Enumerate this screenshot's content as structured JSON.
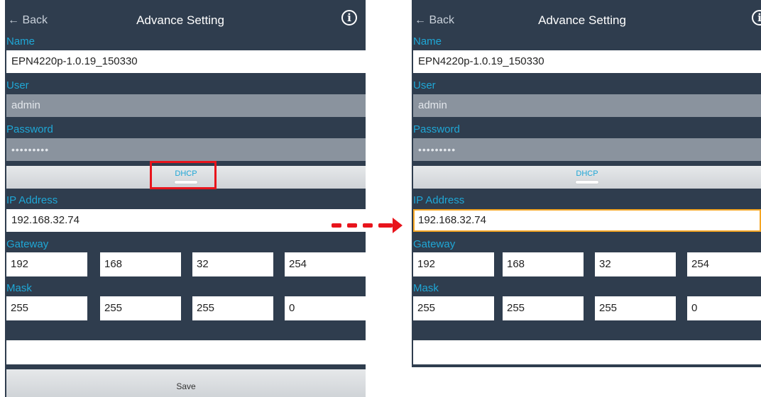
{
  "screens": {
    "before": {
      "back_label": "← Back",
      "title": "Advance Setting",
      "info_icon": "i",
      "name_label": "Name",
      "name_value": "EPN4220p-1.0.19_150330",
      "user_label": "User",
      "user_value": "admin",
      "password_label": "Password",
      "password_value": "•••••••••",
      "dhcp_label": "DHCP",
      "ip_label": "IP Address",
      "ip_value": "192.168.32.74",
      "gateway_label": "Gateway",
      "gateway": [
        "192",
        "168",
        "32",
        "254"
      ],
      "mask_label": "Mask",
      "mask": [
        "255",
        "255",
        "255",
        "0"
      ],
      "save_label": "Save"
    },
    "after": {
      "back_label": "← Back",
      "title": "Advance Setting",
      "info_icon": "i",
      "name_label": "Name",
      "name_value": "EPN4220p-1.0.19_150330",
      "user_label": "User",
      "user_value": "admin",
      "password_label": "Password",
      "password_value": "•••••••••",
      "dhcp_label": "DHCP",
      "ip_label": "IP Address",
      "ip_value": "192.168.32.74",
      "gateway_label": "Gateway",
      "gateway": [
        "192",
        "168",
        "32",
        "254"
      ],
      "mask_label": "Mask",
      "mask": [
        "255",
        "255",
        "255",
        "0"
      ]
    }
  },
  "colors": {
    "background": "#2f3d4e",
    "label": "#1fa7d6",
    "highlight": "#e8141c",
    "focus": "#f5a623"
  }
}
